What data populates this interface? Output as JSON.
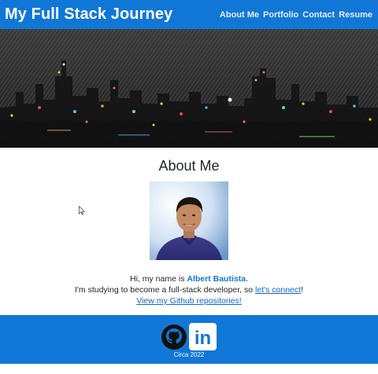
{
  "header": {
    "brand": "My Full Stack Journey",
    "nav": [
      "About Me",
      "Portfolio",
      "Contact",
      "Resume"
    ]
  },
  "about": {
    "title": "About Me",
    "greeting_prefix": "Hi, my name is ",
    "name": "Albert Bautista",
    "greeting_suffix": ".",
    "line2_prefix": "I'm studying to become a full-stack developer, so ",
    "connect_link": "let's connect",
    "line2_suffix": "!",
    "github_link": "View my Github repositories!"
  },
  "footer": {
    "circa": "Circa 2022",
    "icons": [
      "github-icon",
      "linkedin-icon"
    ],
    "linkedin_text": "in"
  },
  "colors": {
    "brand_blue": "#1177d6",
    "link_blue": "#1164d6"
  }
}
